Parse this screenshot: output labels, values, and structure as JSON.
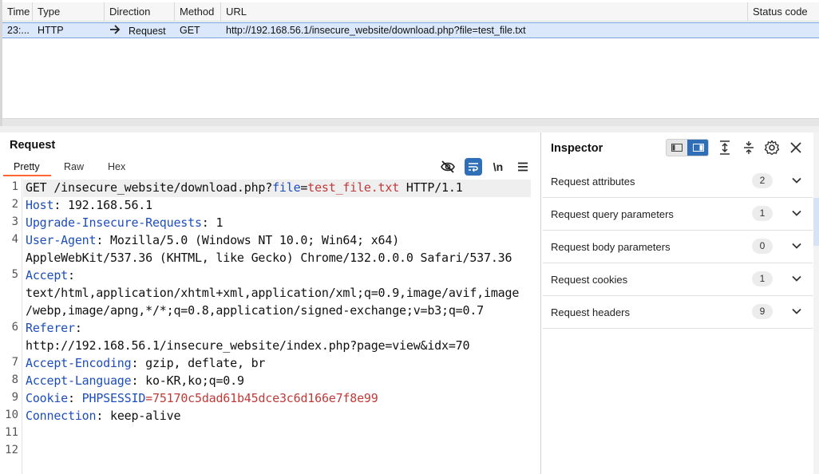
{
  "history": {
    "columns": [
      "Time",
      "Type",
      "Direction",
      "Method",
      "URL",
      "Status code"
    ],
    "row": {
      "time": "23:...",
      "type": "HTTP",
      "direction": "Request",
      "method": "GET",
      "url": "http://192.168.56.1/insecure_website/download.php?file=test_file.txt"
    }
  },
  "request": {
    "title": "Request",
    "tabs": [
      "Pretty",
      "Raw",
      "Hex"
    ],
    "active_tab": "Pretty",
    "toolbar": {
      "hide_icon": "eye-slash-icon",
      "wrap_icon": "wrap-lines-icon",
      "newline_label": "\\n",
      "menu_icon": "hamburger-menu-icon"
    },
    "line_numbers": [
      "1",
      "2",
      "3",
      "4",
      "5",
      "6",
      "7",
      "8",
      "9",
      "10",
      "11",
      "12"
    ],
    "lines": [
      {
        "method": "GET /insecure_website/download.php?",
        "param": "file",
        "eq": "=",
        "val": "test_file.txt",
        "tail": " HTTP/1.1"
      },
      {
        "key": "Host",
        "sep": ": ",
        "value": "192.168.56.1"
      },
      {
        "key": "Upgrade-Insecure-Requests",
        "sep": ": ",
        "value": "1"
      },
      {
        "key": "User-Agent",
        "sep": ": ",
        "value": "Mozilla/5.0 (Windows NT 10.0; Win64; x64)"
      },
      {
        "cont": "AppleWebKit/537.36 (KHTML, like Gecko) Chrome/132.0.0.0 Safari/537.36"
      },
      {
        "key": "Accept",
        "sep": ":",
        "value": ""
      },
      {
        "cont": "text/html,application/xhtml+xml,application/xml;q=0.9,image/avif,image"
      },
      {
        "cont": "/webp,image/apng,*/*;q=0.8,application/signed-exchange;v=b3;q=0.7"
      },
      {
        "key": "Referer",
        "sep": ":",
        "value": ""
      },
      {
        "cont": "http://192.168.56.1/insecure_website/index.php?page=view&idx=70"
      },
      {
        "key": "Accept-Encoding",
        "sep": ": ",
        "value": "gzip, deflate, br"
      },
      {
        "key": "Accept-Language",
        "sep": ": ",
        "value": "ko-KR,ko;q=0.9"
      },
      {
        "key": "Cookie",
        "sep": ": ",
        "ckey": "PHPSESSID",
        "ceq": "=",
        "cval": "75170c5dad61b45dce3c6d166e7f8e99"
      },
      {
        "key": "Connection",
        "sep": ": ",
        "value": "keep-alive"
      }
    ]
  },
  "inspector": {
    "title": "Inspector",
    "sections": [
      {
        "label": "Request attributes",
        "count": "2"
      },
      {
        "label": "Request query parameters",
        "count": "1"
      },
      {
        "label": "Request body parameters",
        "count": "0"
      },
      {
        "label": "Request cookies",
        "count": "1"
      },
      {
        "label": "Request headers",
        "count": "9"
      }
    ]
  },
  "colors": {
    "selected_row": "#dbe8fb",
    "accent": "#2f6fb7",
    "header_key": "#1d4ebb",
    "param_value": "#c03a3a",
    "tab_underline": "#ff6633"
  }
}
